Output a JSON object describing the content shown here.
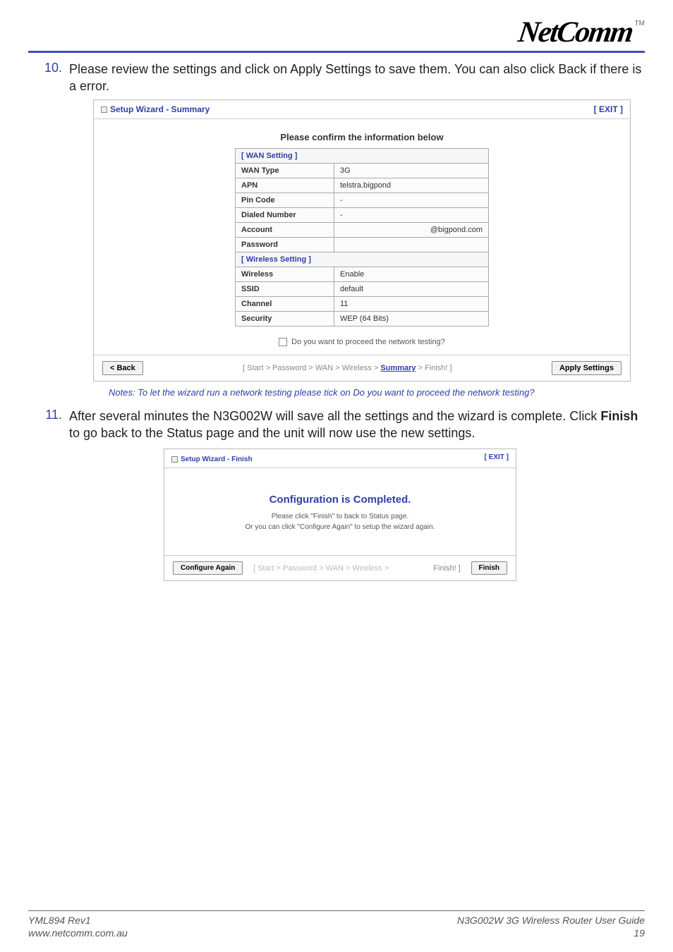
{
  "brand": {
    "name": "NetComm",
    "tm": "TM"
  },
  "step10": {
    "num": "10.",
    "text": "Please review the settings and click on Apply Settings to save them. You can also click Back if there is a error."
  },
  "summary_panel": {
    "title": "Setup Wizard - Summary",
    "exit": "[ EXIT ]",
    "heading": "Please confirm the information below",
    "wan_section": "[ WAN Setting ]",
    "rows_wan": [
      {
        "label": "WAN Type",
        "value": "3G"
      },
      {
        "label": "APN",
        "value": "telstra.bigpond"
      },
      {
        "label": "Pin Code",
        "value": "-"
      },
      {
        "label": "Dialed Number",
        "value": "-"
      },
      {
        "label": "Account",
        "value": "@bigpond.com",
        "align": "right"
      },
      {
        "label": "Password",
        "value": ""
      }
    ],
    "wireless_section": "[ Wireless Setting ]",
    "rows_wireless": [
      {
        "label": "Wireless",
        "value": "Enable"
      },
      {
        "label": "SSID",
        "value": "default"
      },
      {
        "label": "Channel",
        "value": "11"
      },
      {
        "label": "Security",
        "value": "WEP (64 Bits)"
      }
    ],
    "checkbox_label": "Do you want to proceed the network testing?",
    "back_btn": "< Back",
    "breadcrumb": {
      "prefix": "[ Start > Password > WAN > Wireless > ",
      "current": "Summary",
      "suffix": " > Finish! ]"
    },
    "apply_btn": "Apply Settings"
  },
  "note_text": "Notes: To let the wizard run a network testing please tick on Do you want to proceed the network testing?",
  "step11": {
    "num": "11.",
    "text_a": "After several minutes the N3G002W will save all the settings and the wizard is complete. Click ",
    "finish_word": "Finish",
    "text_b": " to go back to the Status page and the unit will now use the new settings."
  },
  "finish_panel": {
    "title": "Setup Wizard - Finish",
    "exit": "[ EXIT ]",
    "heading": "Configuration is Completed.",
    "line1": "Please click \"Finish\" to back to Status page.",
    "line2": "Or you can click \"Configure Again\" to setup the wizard again.",
    "config_btn": "Configure Again",
    "breadcrumb": "[ Start > Password > WAN > Wireless >",
    "finish_bc": "Finish! ]",
    "finish_btn": "Finish"
  },
  "footer": {
    "rev": "YML894 Rev1",
    "url": "www.netcomm.com.au",
    "guide": "N3G002W 3G Wireless Router User Guide",
    "page_num": "19"
  }
}
